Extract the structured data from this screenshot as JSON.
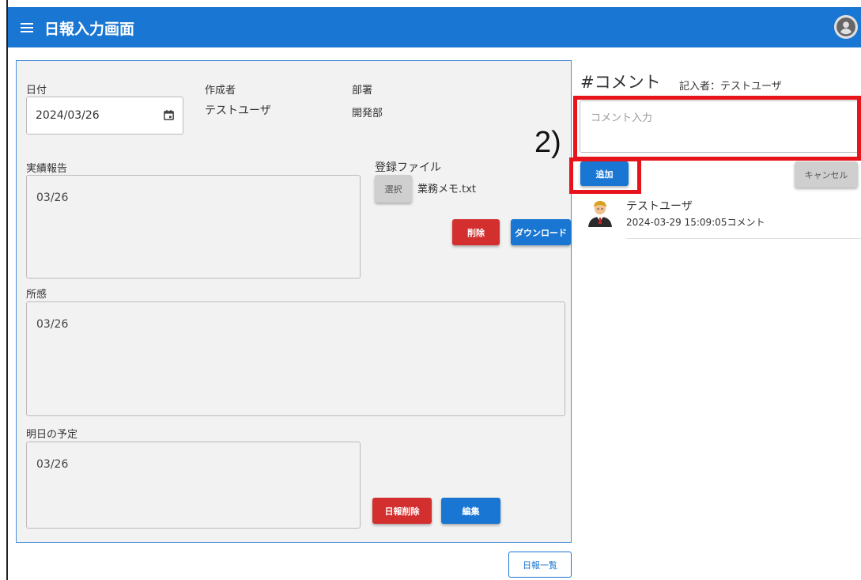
{
  "appbar": {
    "title": "日報入力画面",
    "menu_icon": "hamburger-menu-icon",
    "account_icon": "account-circle-icon"
  },
  "form": {
    "date_label": "日付",
    "date_value": "2024/03/26",
    "author_label": "作成者",
    "author_value": "テストユーザ",
    "dept_label": "部署",
    "dept_value": "開発部",
    "report_label": "実績報告",
    "report_value": "03/26",
    "files_label": "登録ファイル",
    "select_button": "選択",
    "file_name": "業務メモ.txt",
    "delete_file_button": "削除",
    "download_button": "ダウンロード",
    "impression_label": "所感",
    "impression_value": "03/26",
    "plan_label": "明日の予定",
    "plan_value": "03/26",
    "delete_report_button": "日報削除",
    "edit_button": "編集"
  },
  "footer": {
    "list_button": "日報一覧"
  },
  "comments": {
    "title": "#コメント",
    "writer": "記入者：テストユーザ",
    "input_placeholder": "コメント入力",
    "add_button": "追加",
    "cancel_button": "キャンセル",
    "items": [
      {
        "user": "テストユーザ",
        "meta": "2024-03-29 15:09:05コメント"
      }
    ]
  },
  "annotation": {
    "step": "2)",
    "color": "#e8141b"
  },
  "colors": {
    "primary": "#1976d2",
    "danger": "#d32f2f"
  }
}
